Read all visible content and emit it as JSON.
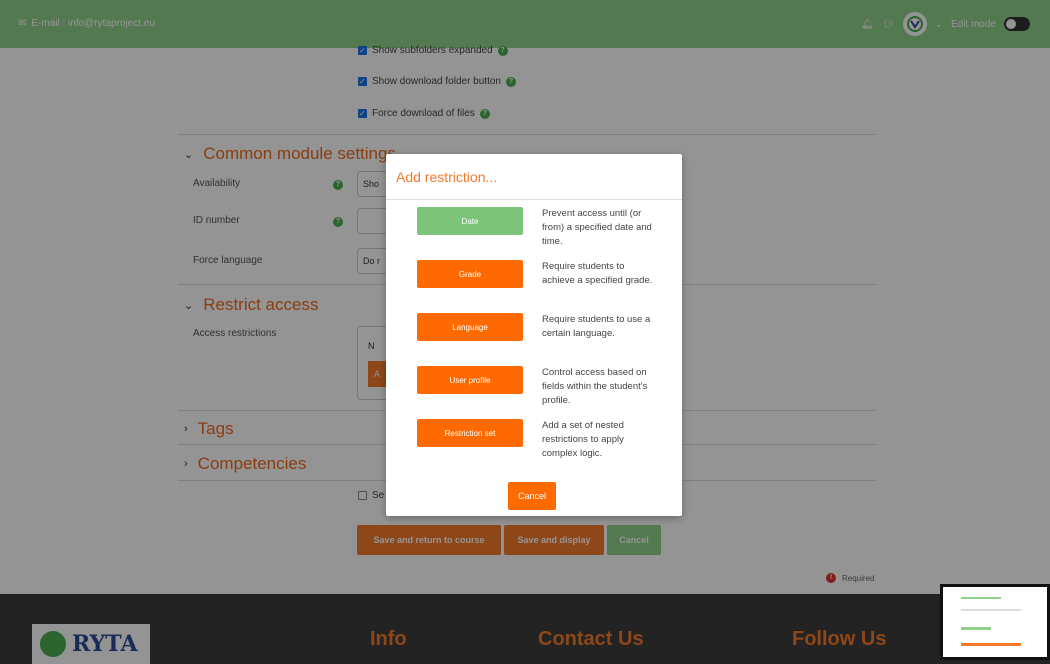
{
  "topbar": {
    "email": "E-mail : info@rytaproject.eu",
    "edit_mode": "Edit mode"
  },
  "form": {
    "checkboxes": [
      "Show subfolders expanded",
      "Show download folder button",
      "Force download of files"
    ],
    "sections": {
      "common": "Common module settings",
      "restrict": "Restrict access",
      "tags": "Tags",
      "competencies": "Competencies"
    },
    "fields": {
      "availability_label": "Availability",
      "availability_value": "Sho",
      "id_number_label": "ID number",
      "force_language_label": "Force language",
      "force_language_value": "Do r",
      "access_restrictions_label": "Access restrictions",
      "access_partial_text": "N",
      "access_partial_button": "A",
      "send_partial": "Se"
    },
    "buttons": {
      "save_return": "Save and return to course",
      "save_display": "Save and display",
      "cancel": "Cancel"
    },
    "required": "Required"
  },
  "modal": {
    "title": "Add restriction...",
    "options": [
      {
        "label": "Date",
        "desc": "Prevent access until (or from) a specified date and time."
      },
      {
        "label": "Grade",
        "desc": "Require students to achieve a specified grade."
      },
      {
        "label": "Language",
        "desc": "Require students to use a certain language."
      },
      {
        "label": "User profile",
        "desc": "Control access based on fields within the student's profile."
      },
      {
        "label": "Restriction set",
        "desc": "Add a set of nested restrictions to apply complex logic."
      }
    ],
    "cancel": "Cancel"
  },
  "footer": {
    "logo": "RYTA",
    "info": "Info",
    "contact": "Contact Us",
    "follow": "Follow Us"
  },
  "colors": {
    "accent_orange": "#ff6a00",
    "brand_green": "#8fd18a"
  }
}
